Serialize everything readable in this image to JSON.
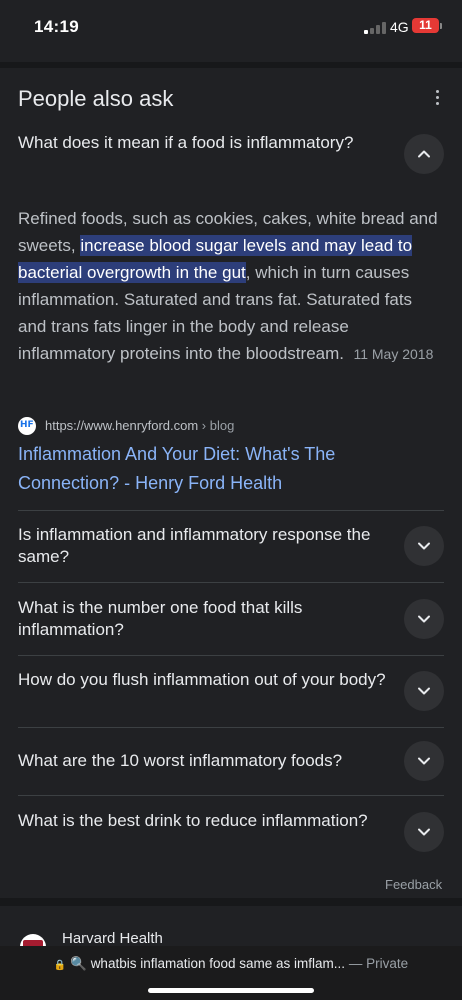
{
  "status": {
    "time": "14:19",
    "network": "4G",
    "battery": "11"
  },
  "paa": {
    "title": "People also ask",
    "expanded": {
      "question": "What does it mean if a food is inflammatory?",
      "answer_pre": "Refined foods, such as cookies, cakes, white bread and sweets, ",
      "answer_highlight": "increase blood sugar levels and may lead to bacterial overgrowth in the gut",
      "answer_post": ", which in turn causes inflammation. Saturated and trans fat. Saturated fats and trans fats linger in the body and release inflammatory proteins into the bloodstream.",
      "date": "11 May 2018",
      "source_icon": "HF",
      "source_url": "https://www.henryford.com",
      "source_crumb": " › blog",
      "link_title": "Inflammation And Your Diet: What's The Connection? - Henry Ford Health"
    },
    "questions": [
      "Is inflammation and inflammatory response the same?",
      "What is the number one food that kills inflammation?",
      "How do you flush inflammation out of your body?",
      "What are the 10 worst inflammatory foods?",
      "What is the best drink to reduce inflammation?"
    ],
    "feedback": "Feedback"
  },
  "next_result": {
    "site_name": "Harvard Health"
  },
  "address_bar": {
    "query": "whatbis inflamation food same as imflam...",
    "mode": "— Private"
  },
  "icons": [
    "more-vert-icon",
    "chevron-up-icon",
    "chevron-down-icon",
    "lock-icon",
    "search-icon"
  ],
  "colors": {
    "background": "#202124",
    "link": "#8ab4f8",
    "highlight": "#2d3e7a",
    "battery": "#e53935"
  }
}
